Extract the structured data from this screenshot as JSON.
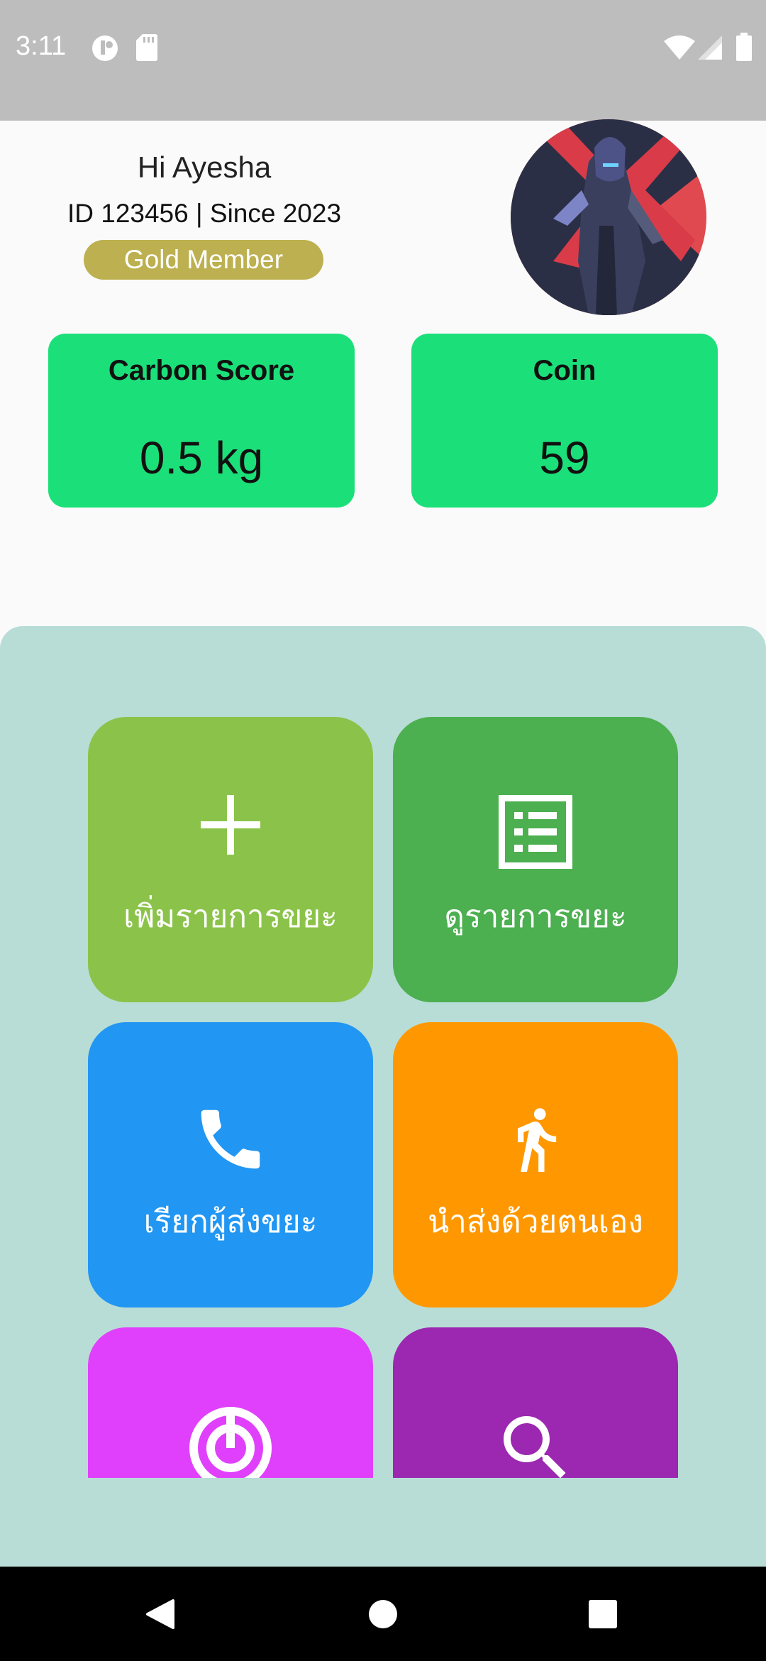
{
  "status_bar": {
    "time": "3:11",
    "icons": [
      "notification-icon",
      "sd-card-icon",
      "wifi-icon",
      "signal-icon",
      "battery-icon"
    ]
  },
  "profile": {
    "greeting": "Hi  Ayesha",
    "id_line": "ID 123456 | Since 2023",
    "membership": "Gold Member",
    "avatar": "avatar-image"
  },
  "stats": {
    "carbon": {
      "label": "Carbon Score",
      "value": "0.5 kg"
    },
    "coin": {
      "label": "Coin",
      "value": "59"
    }
  },
  "menu": {
    "tiles": [
      {
        "label": "เพิ่มรายการขยะ",
        "icon": "plus-icon",
        "color": "#8bc34a"
      },
      {
        "label": "ดูรายการขยะ",
        "icon": "list-icon",
        "color": "#4caf50"
      },
      {
        "label": "เรียกผู้ส่งขยะ",
        "icon": "phone-icon",
        "color": "#2196f3"
      },
      {
        "label": "นำส่งด้วยตนเอง",
        "icon": "walk-icon",
        "color": "#ff9800"
      },
      {
        "label": "",
        "icon": "radar-icon",
        "color": "#e040fb"
      },
      {
        "label": "",
        "icon": "search-icon",
        "color": "#9c27b0"
      }
    ]
  },
  "nav": {
    "back": "back-icon",
    "home": "home-icon",
    "recents": "recents-icon"
  },
  "colors": {
    "status_bar": "#bdbdbd",
    "stat_card": "#1be079",
    "badge": "#bcb050",
    "panel": "#b8ddd6"
  }
}
